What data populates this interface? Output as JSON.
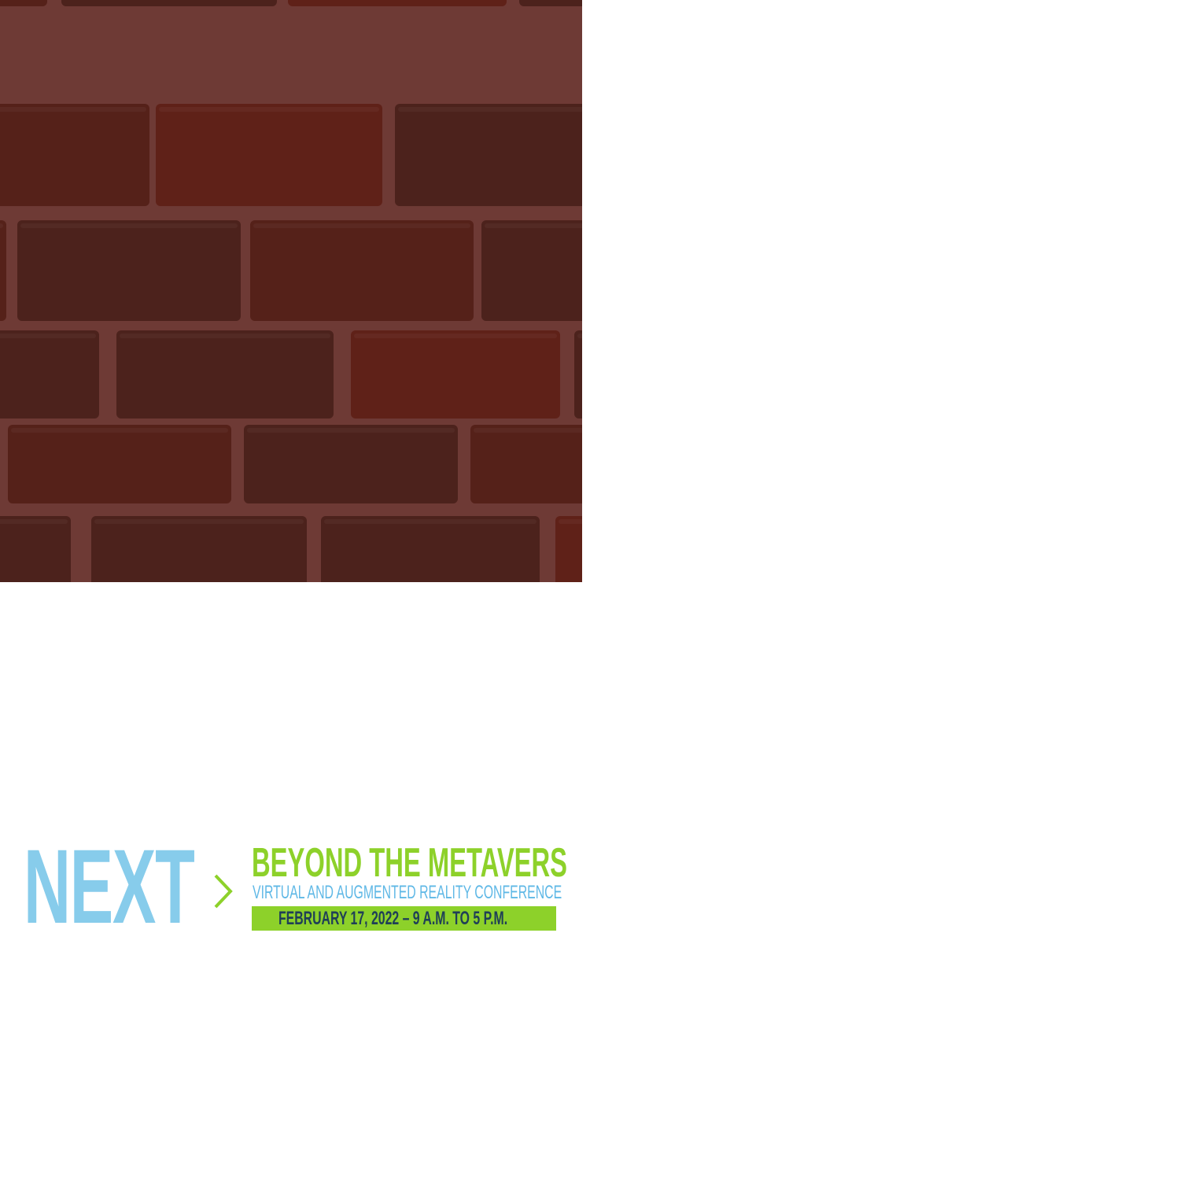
{
  "logo": {
    "word": "NEXT",
    "title": "BEYOND THE METAVERSE",
    "subtitle": "VIRTUAL AND AUGMENTED REALITY CONFERENCE",
    "date_line": "FEBRUARY 17, 2022 – 9 A.M. TO 5 P.M."
  },
  "colors": {
    "next_blue": "#87cceb",
    "title_green": "#8dd12a",
    "subtitle_blue": "#5fb8e6",
    "date_text_navy": "#1f3f57",
    "mortar": "#6e3a35",
    "brick_dark": "#4c221c",
    "brick_mid": "#552119",
    "brick_red": "#5f2118"
  },
  "icons": {
    "separator": "chevron-right-icon"
  }
}
